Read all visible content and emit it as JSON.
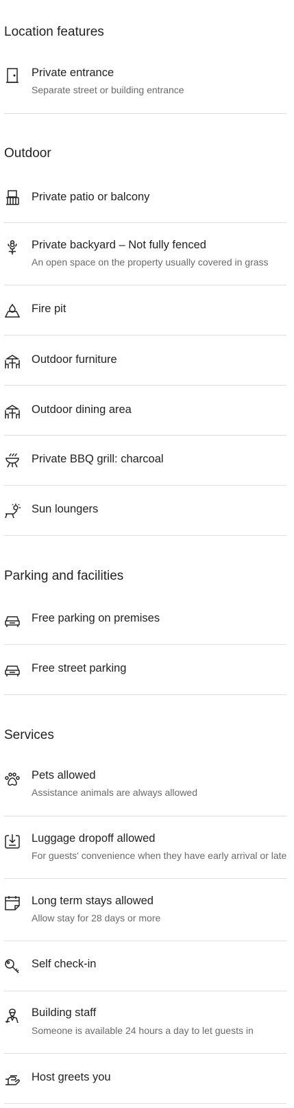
{
  "sections": {
    "location": {
      "title": "Location features",
      "items": [
        {
          "label": "Private entrance",
          "sub": "Separate street or building entrance",
          "icon": "door-icon"
        }
      ]
    },
    "outdoor": {
      "title": "Outdoor",
      "items": [
        {
          "label": "Private patio or balcony",
          "icon": "balcony-icon"
        },
        {
          "label": "Private backyard – Not fully fenced",
          "sub": "An open space on the property usually covered in grass",
          "icon": "flower-icon"
        },
        {
          "label": "Fire pit",
          "icon": "fire-pit-icon"
        },
        {
          "label": "Outdoor furniture",
          "icon": "table-chairs-icon"
        },
        {
          "label": "Outdoor dining area",
          "icon": "dining-table-icon"
        },
        {
          "label": "Private BBQ grill: charcoal",
          "icon": "bbq-grill-icon"
        },
        {
          "label": "Sun loungers",
          "icon": "sun-lounger-icon"
        }
      ]
    },
    "parking": {
      "title": "Parking and facilities",
      "items": [
        {
          "label": "Free parking on premises",
          "icon": "car-icon"
        },
        {
          "label": "Free street parking",
          "icon": "car-icon"
        }
      ]
    },
    "services": {
      "title": "Services",
      "items": [
        {
          "label": "Pets allowed",
          "sub": "Assistance animals are always allowed",
          "icon": "paw-icon"
        },
        {
          "label": "Luggage dropoff allowed",
          "sub": "For guests' convenience when they have early arrival or late",
          "icon": "luggage-icon"
        },
        {
          "label": "Long term stays allowed",
          "sub": "Allow stay for 28 days or more",
          "icon": "calendar-icon"
        },
        {
          "label": "Self check-in",
          "icon": "key-icon"
        },
        {
          "label": "Building staff",
          "sub": "Someone is available 24 hours a day to let guests in",
          "icon": "staff-icon"
        },
        {
          "label": "Host greets you",
          "icon": "hand-icon"
        }
      ]
    }
  }
}
